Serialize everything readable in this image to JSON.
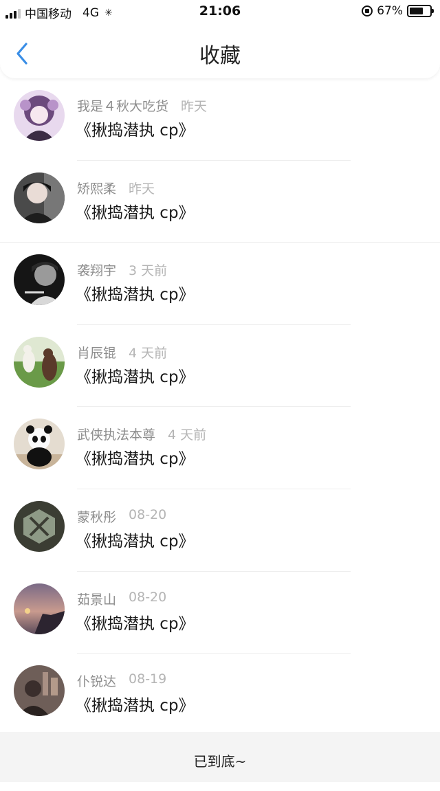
{
  "status_bar": {
    "carrier": "中国移动",
    "network": "4G",
    "time": "21:06",
    "battery_percent": "67%",
    "battery_level": 0.67
  },
  "nav": {
    "back_icon": "chevron-left-icon",
    "title": "收藏",
    "accent_color": "#3a8ee6"
  },
  "items": [
    {
      "user": "我是４秋大吃货",
      "time": "昨天",
      "title": "《揪捣潜执 cp》"
    },
    {
      "user": "矫熙柔",
      "time": "昨天",
      "title": "《揪捣潜执 cp》"
    },
    {
      "user": "袭翔宇",
      "time": "3 天前",
      "title": "《揪捣潜执 cp》"
    },
    {
      "user": "肖辰锟",
      "time": "4 天前",
      "title": "《揪捣潜执 cp》"
    },
    {
      "user": "武侠执法本尊",
      "time": "4 天前",
      "title": "《揪捣潜执 cp》"
    },
    {
      "user": "蒙秋彤",
      "time": "08-20",
      "title": "《揪捣潜执 cp》"
    },
    {
      "user": "茹景山",
      "time": "08-20",
      "title": "《揪捣潜执 cp》"
    },
    {
      "user": "仆锐达",
      "time": "08-19",
      "title": "《揪捣潜执 cp》"
    }
  ],
  "footer": {
    "end_text": "已到底~"
  }
}
